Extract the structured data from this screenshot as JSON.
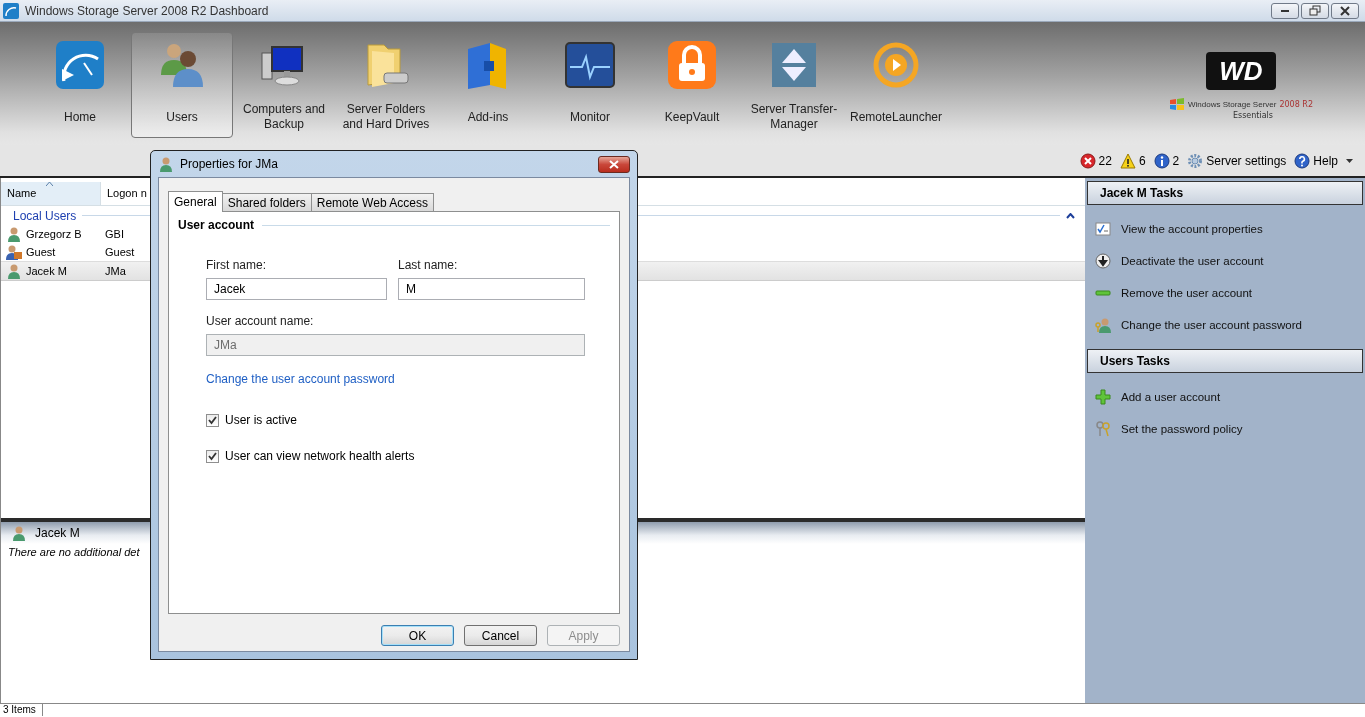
{
  "window": {
    "title": "Windows Storage Server 2008 R2 Dashboard"
  },
  "nav": [
    {
      "label": "Home",
      "selected": false
    },
    {
      "label": "Users",
      "selected": true
    },
    {
      "label": "Computers and Backup",
      "selected": false
    },
    {
      "label": "Server Folders and Hard Drives",
      "selected": false
    },
    {
      "label": "Add-ins",
      "selected": false
    },
    {
      "label": "Monitor",
      "selected": false
    },
    {
      "label": "KeepVault",
      "selected": false
    },
    {
      "label": "Server Transfer-Manager",
      "selected": false
    },
    {
      "label": "RemoteLauncher",
      "selected": false
    }
  ],
  "brand": {
    "logo": "WD",
    "product": "Windows Storage Server",
    "version": "2008 R2",
    "edition": "Essentials"
  },
  "alerts": [
    {
      "kind": "error",
      "count": "22"
    },
    {
      "kind": "warning",
      "count": "6"
    },
    {
      "kind": "info",
      "count": "2"
    }
  ],
  "toolbar_links": [
    {
      "kind": "settings",
      "label": "Server settings"
    },
    {
      "kind": "help",
      "label": "Help"
    }
  ],
  "list": {
    "columns": [
      {
        "label": "Name",
        "sorted": true
      },
      {
        "label": "Logon n",
        "sorted": false
      }
    ],
    "groups": [
      {
        "label": "Local Users",
        "expanded": true,
        "rows": [
          {
            "kind": "user",
            "name": "Grzegorz B",
            "logon": "GBI",
            "selected": false
          },
          {
            "kind": "guest",
            "name": "Guest",
            "logon": "Guest",
            "selected": false
          },
          {
            "kind": "user",
            "name": "Jacek M",
            "logon": "JMa",
            "selected": true
          }
        ]
      }
    ]
  },
  "details": {
    "title": "Jacek M",
    "text": "There are no additional det"
  },
  "status_bar": {
    "text": "3 Items"
  },
  "task_panes": [
    {
      "title": "Jacek M Tasks",
      "items": [
        {
          "kind": "properties",
          "label": "View the account properties"
        },
        {
          "kind": "deactivate",
          "label": "Deactivate the user account"
        },
        {
          "kind": "remove",
          "label": "Remove the user account"
        },
        {
          "kind": "password",
          "label": "Change the user account password"
        }
      ]
    },
    {
      "title": "Users Tasks",
      "items": [
        {
          "kind": "add",
          "label": "Add a user account"
        },
        {
          "kind": "policy",
          "label": "Set the password policy"
        }
      ]
    }
  ],
  "dialog": {
    "title": "Properties for JMa",
    "tabs": [
      {
        "label": "General",
        "selected": true
      },
      {
        "label": "Shared folders",
        "selected": false
      },
      {
        "label": "Remote Web Access",
        "selected": false
      }
    ],
    "section": "User account",
    "fields": [
      {
        "label": "First name:",
        "value": "Jacek",
        "disabled": false
      },
      {
        "label": "Last name:",
        "value": "M",
        "disabled": false
      },
      {
        "label": "User account name:",
        "value": "JMa",
        "disabled": true
      }
    ],
    "link": "Change the user account password",
    "checkboxes": [
      {
        "label": "User is active",
        "checked": true
      },
      {
        "label": "User can view network health alerts",
        "checked": true
      }
    ],
    "buttons": [
      {
        "label": "OK",
        "default": true,
        "disabled": false
      },
      {
        "label": "Cancel",
        "default": false,
        "disabled": false
      },
      {
        "label": "Apply",
        "default": false,
        "disabled": true
      }
    ]
  }
}
